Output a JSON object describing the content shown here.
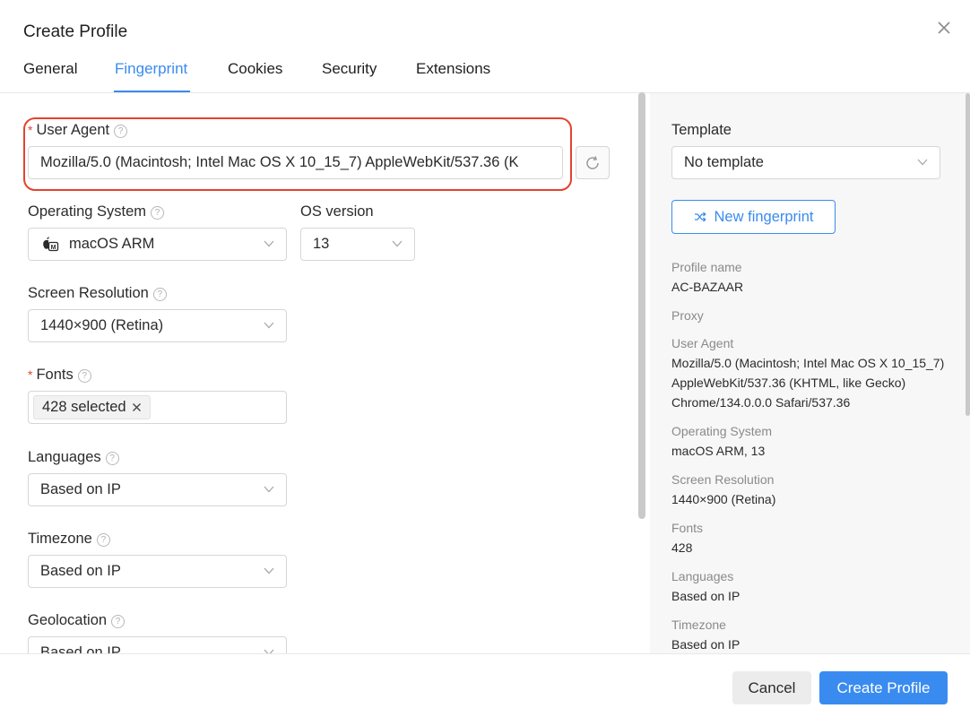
{
  "dialog": {
    "title": "Create Profile"
  },
  "tabs": [
    {
      "label": "General",
      "active": false
    },
    {
      "label": "Fingerprint",
      "active": true
    },
    {
      "label": "Cookies",
      "active": false
    },
    {
      "label": "Security",
      "active": false
    },
    {
      "label": "Extensions",
      "active": false
    }
  ],
  "form": {
    "user_agent": {
      "label": "User Agent",
      "value": "Mozilla/5.0 (Macintosh; Intel Mac OS X 10_15_7) AppleWebKit/537.36 (K"
    },
    "os": {
      "label": "Operating System",
      "value": "macOS ARM"
    },
    "os_version": {
      "label": "OS version",
      "value": "13"
    },
    "screen": {
      "label": "Screen Resolution",
      "value": "1440×900 (Retina)"
    },
    "fonts": {
      "label": "Fonts",
      "tag": "428 selected"
    },
    "languages": {
      "label": "Languages",
      "value": "Based on IP"
    },
    "timezone": {
      "label": "Timezone",
      "value": "Based on IP"
    },
    "geolocation": {
      "label": "Geolocation",
      "value": "Based on IP"
    }
  },
  "summary": {
    "template_label": "Template",
    "template_value": "No template",
    "new_fingerprint": "New fingerprint",
    "items": [
      {
        "key": "Profile name",
        "value": "AC-BAZAAR"
      },
      {
        "key": "Proxy",
        "value": ""
      },
      {
        "key": "User Agent",
        "value": "Mozilla/5.0 (Macintosh; Intel Mac OS X 10_15_7) AppleWebKit/537.36 (KHTML, like Gecko) Chrome/134.0.0.0 Safari/537.36"
      },
      {
        "key": "Operating System",
        "value": "macOS ARM, 13"
      },
      {
        "key": "Screen Resolution",
        "value": "1440×900 (Retina)"
      },
      {
        "key": "Fonts",
        "value": "428"
      },
      {
        "key": "Languages",
        "value": "Based on IP"
      },
      {
        "key": "Timezone",
        "value": "Based on IP"
      }
    ]
  },
  "footer": {
    "cancel": "Cancel",
    "create": "Create Profile"
  },
  "colors": {
    "accent": "#3a8bf0",
    "highlight_border": "#e5422e",
    "required": "#e0463b"
  },
  "icons": {
    "close": "close-icon",
    "reload": "reload-icon",
    "chevron": "chevron-down-icon",
    "help": "help-icon",
    "shuffle": "shuffle-icon",
    "apple": "apple-icon",
    "tag_remove": "close-icon"
  }
}
